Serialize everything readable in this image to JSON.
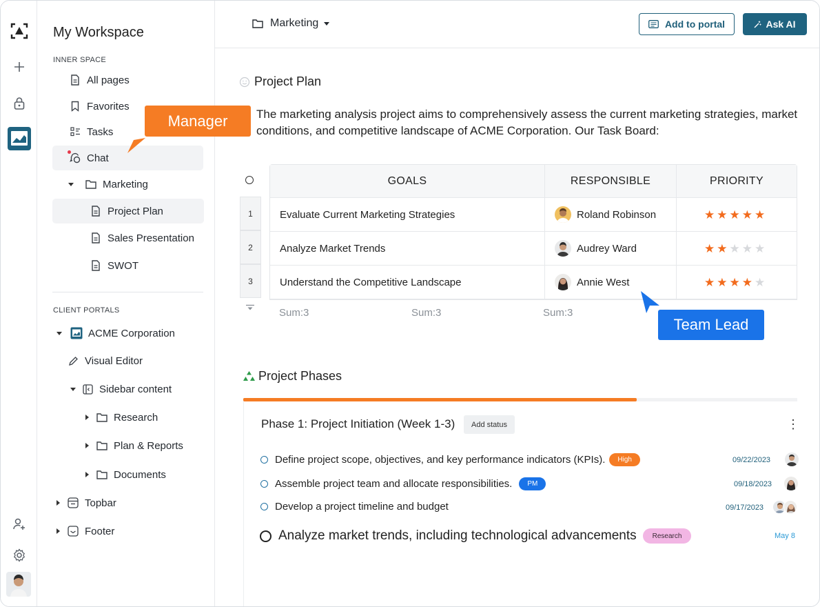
{
  "sidebar": {
    "title": "My Workspace",
    "inner_space_label": "INNER SPACE",
    "inner_items": [
      "All pages",
      "Favorites",
      "Tasks",
      "Chat"
    ],
    "marketing": "Marketing",
    "marketing_pages": [
      "Project Plan",
      "Sales Presentation",
      "SWOT"
    ],
    "client_portals_label": "CLIENT PORTALS",
    "portal_name": "ACME Corporation",
    "portal_items": [
      "Visual Editor",
      "Sidebar content"
    ],
    "sidebar_folders": [
      "Research",
      "Plan & Reports",
      "Documents"
    ],
    "bottom_items": [
      "Topbar",
      "Footer"
    ]
  },
  "tooltips": {
    "manager": "Manager",
    "team_lead": "Team Lead"
  },
  "header": {
    "breadcrumb": "Marketing",
    "add_to_portal": "Add to portal",
    "ask_ai": "Ask AI"
  },
  "page": {
    "title": "Project Plan",
    "description": "The marketing analysis project aims to comprehensively assess the current marketing strategies, market conditions, and competitive landscape of ACME Corporation. Our Task Board:"
  },
  "table": {
    "columns": [
      "GOALS",
      "RESPONSIBLE",
      "PRIORITY"
    ],
    "rows": [
      {
        "num": "1",
        "goal": "Evaluate Current Marketing Strategies",
        "responsible": "Roland Robinson",
        "priority": 5
      },
      {
        "num": "2",
        "goal": "Analyze Market Trends",
        "responsible": "Audrey Ward",
        "priority": 2
      },
      {
        "num": "3",
        "goal": "Understand the Competitive Landscape",
        "responsible": "Annie West",
        "priority": 4
      }
    ],
    "sums": [
      "Sum:3",
      "Sum:3",
      "Sum:3"
    ]
  },
  "phases": {
    "title": "Project Phases",
    "progress": 0.71,
    "phase1_title": "Phase 1: Project Initiation (Week 1-3)",
    "add_status": "Add status",
    "tasks": [
      {
        "text": "Define project scope, objectives, and key performance indicators (KPIs).",
        "tag": "High",
        "date": "09/22/2023"
      },
      {
        "text": "Assemble project team and allocate responsibilities.",
        "tag": "PM",
        "date": "09/18/2023"
      },
      {
        "text": "Develop a project timeline and budget",
        "tag": "",
        "date": "09/17/2023"
      },
      {
        "text": "Analyze market trends, including technological advancements",
        "tag": "Research",
        "date": "May 8"
      }
    ]
  },
  "colors": {
    "accent": "#1f6380",
    "orange": "#f57c24",
    "blue_tip": "#1a73e8",
    "star": "#f26b1d"
  }
}
